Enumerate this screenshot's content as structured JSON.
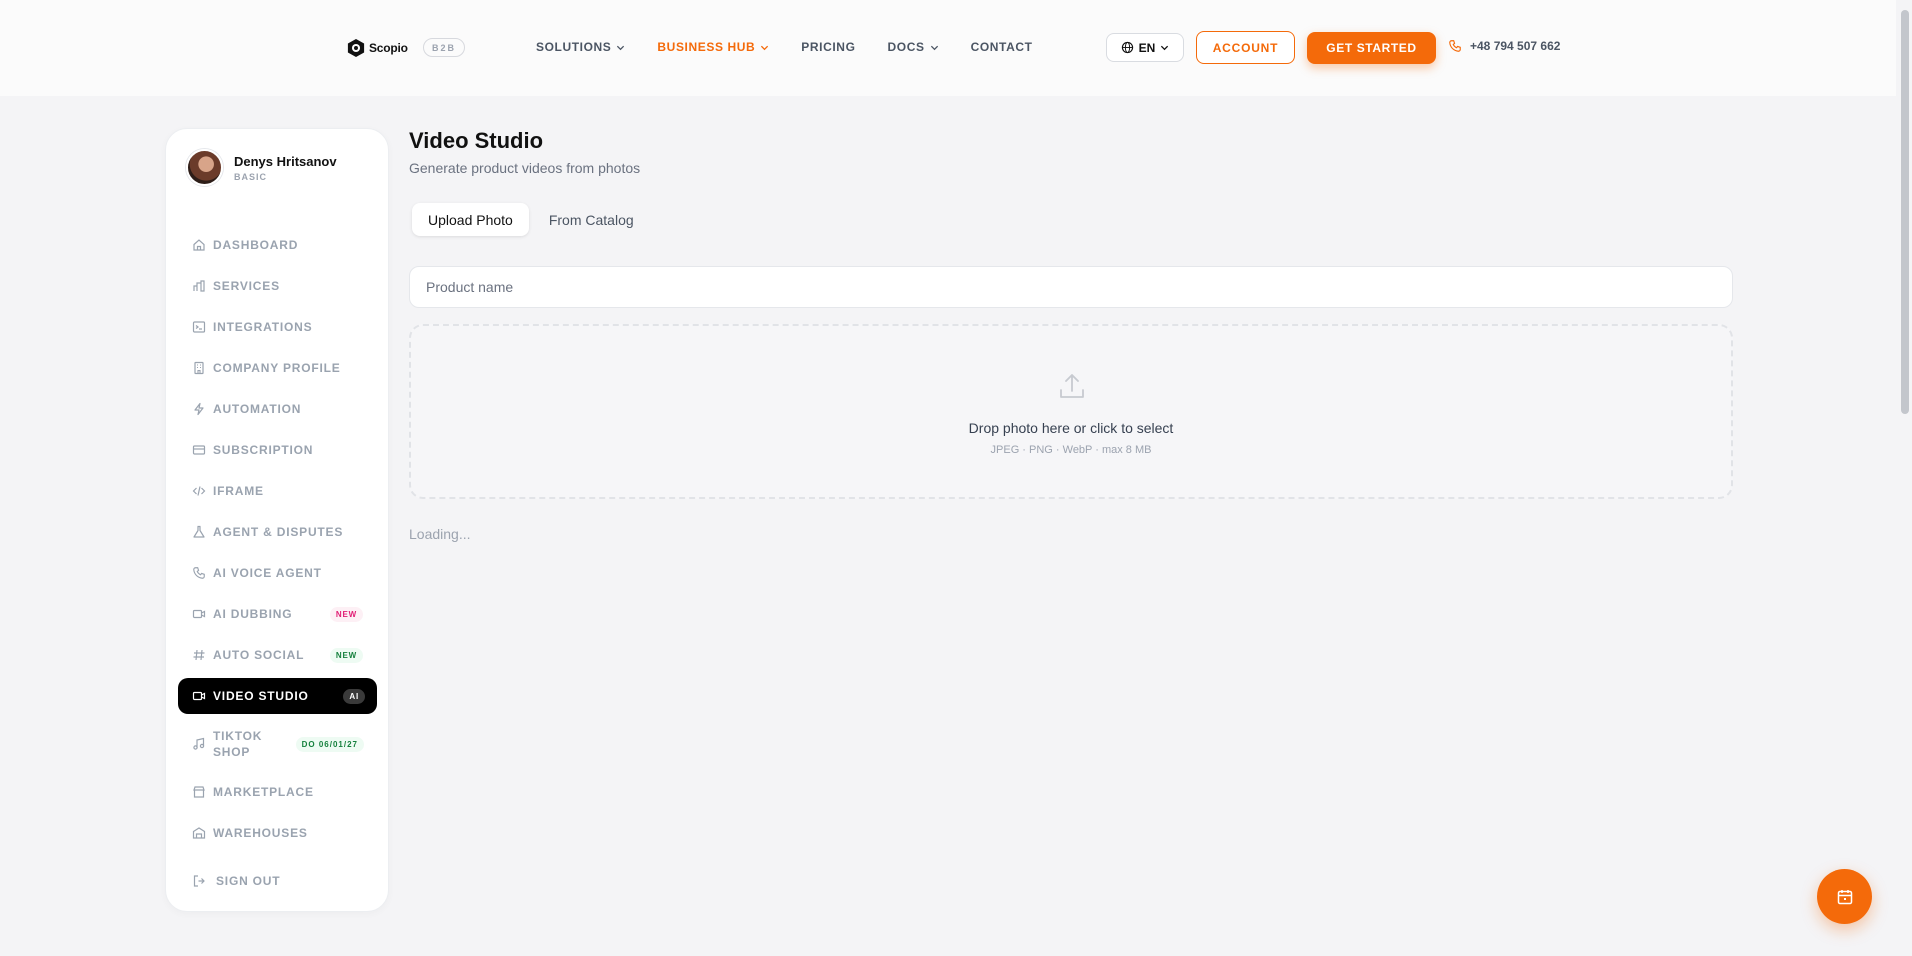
{
  "header": {
    "logo_text": "Scopio",
    "badge": "B2B",
    "nav": [
      {
        "label": "SOLUTIONS",
        "dropdown": true
      },
      {
        "label": "BUSINESS HUB",
        "dropdown": true,
        "active": true
      },
      {
        "label": "PRICING",
        "dropdown": false
      },
      {
        "label": "DOCS",
        "dropdown": true
      },
      {
        "label": "CONTACT",
        "dropdown": false
      }
    ],
    "language": "EN",
    "account_label": "ACCOUNT",
    "get_started_label": "GET STARTED",
    "phone": "+48 794 507 662"
  },
  "user": {
    "name": "Denys Hritsanov",
    "plan": "BASIC"
  },
  "sidebar": {
    "items": [
      {
        "label": "DASHBOARD",
        "icon": "home-icon"
      },
      {
        "label": "SERVICES",
        "icon": "bar-chart-icon"
      },
      {
        "label": "INTEGRATIONS",
        "icon": "terminal-icon"
      },
      {
        "label": "COMPANY PROFILE",
        "icon": "building-icon"
      },
      {
        "label": "AUTOMATION",
        "icon": "bolt-icon"
      },
      {
        "label": "SUBSCRIPTION",
        "icon": "card-icon"
      },
      {
        "label": "IFRAME",
        "icon": "code-icon"
      },
      {
        "label": "AGENT & DISPUTES",
        "icon": "flask-icon"
      },
      {
        "label": "AI VOICE AGENT",
        "icon": "phone-icon"
      },
      {
        "label": "AI DUBBING",
        "icon": "video-icon",
        "tag": "NEW"
      },
      {
        "label": "AUTO SOCIAL",
        "icon": "hash-icon",
        "tag": "NEW"
      },
      {
        "label": "VIDEO STUDIO",
        "icon": "video-icon",
        "tag": "AI",
        "active": true
      },
      {
        "label": "TIKTOK SHOP",
        "icon": "music-icon",
        "tag": "DO 06/01/27"
      },
      {
        "label": "MARKETPLACE",
        "icon": "store-icon"
      },
      {
        "label": "WAREHOUSES",
        "icon": "warehouse-icon"
      }
    ],
    "sign_out": "SIGN OUT"
  },
  "main": {
    "title": "Video Studio",
    "subtitle": "Generate product videos from photos",
    "tabs": [
      {
        "label": "Upload Photo",
        "active": true
      },
      {
        "label": "From Catalog",
        "active": false
      }
    ],
    "product_name_placeholder": "Product name",
    "dropzone_text": "Drop photo here or click to select",
    "dropzone_hint": "JPEG · PNG · WebP · max 8 MB",
    "loading": "Loading..."
  },
  "colors": {
    "accent": "#f46a0a",
    "active_menu_bg": "#000000"
  }
}
